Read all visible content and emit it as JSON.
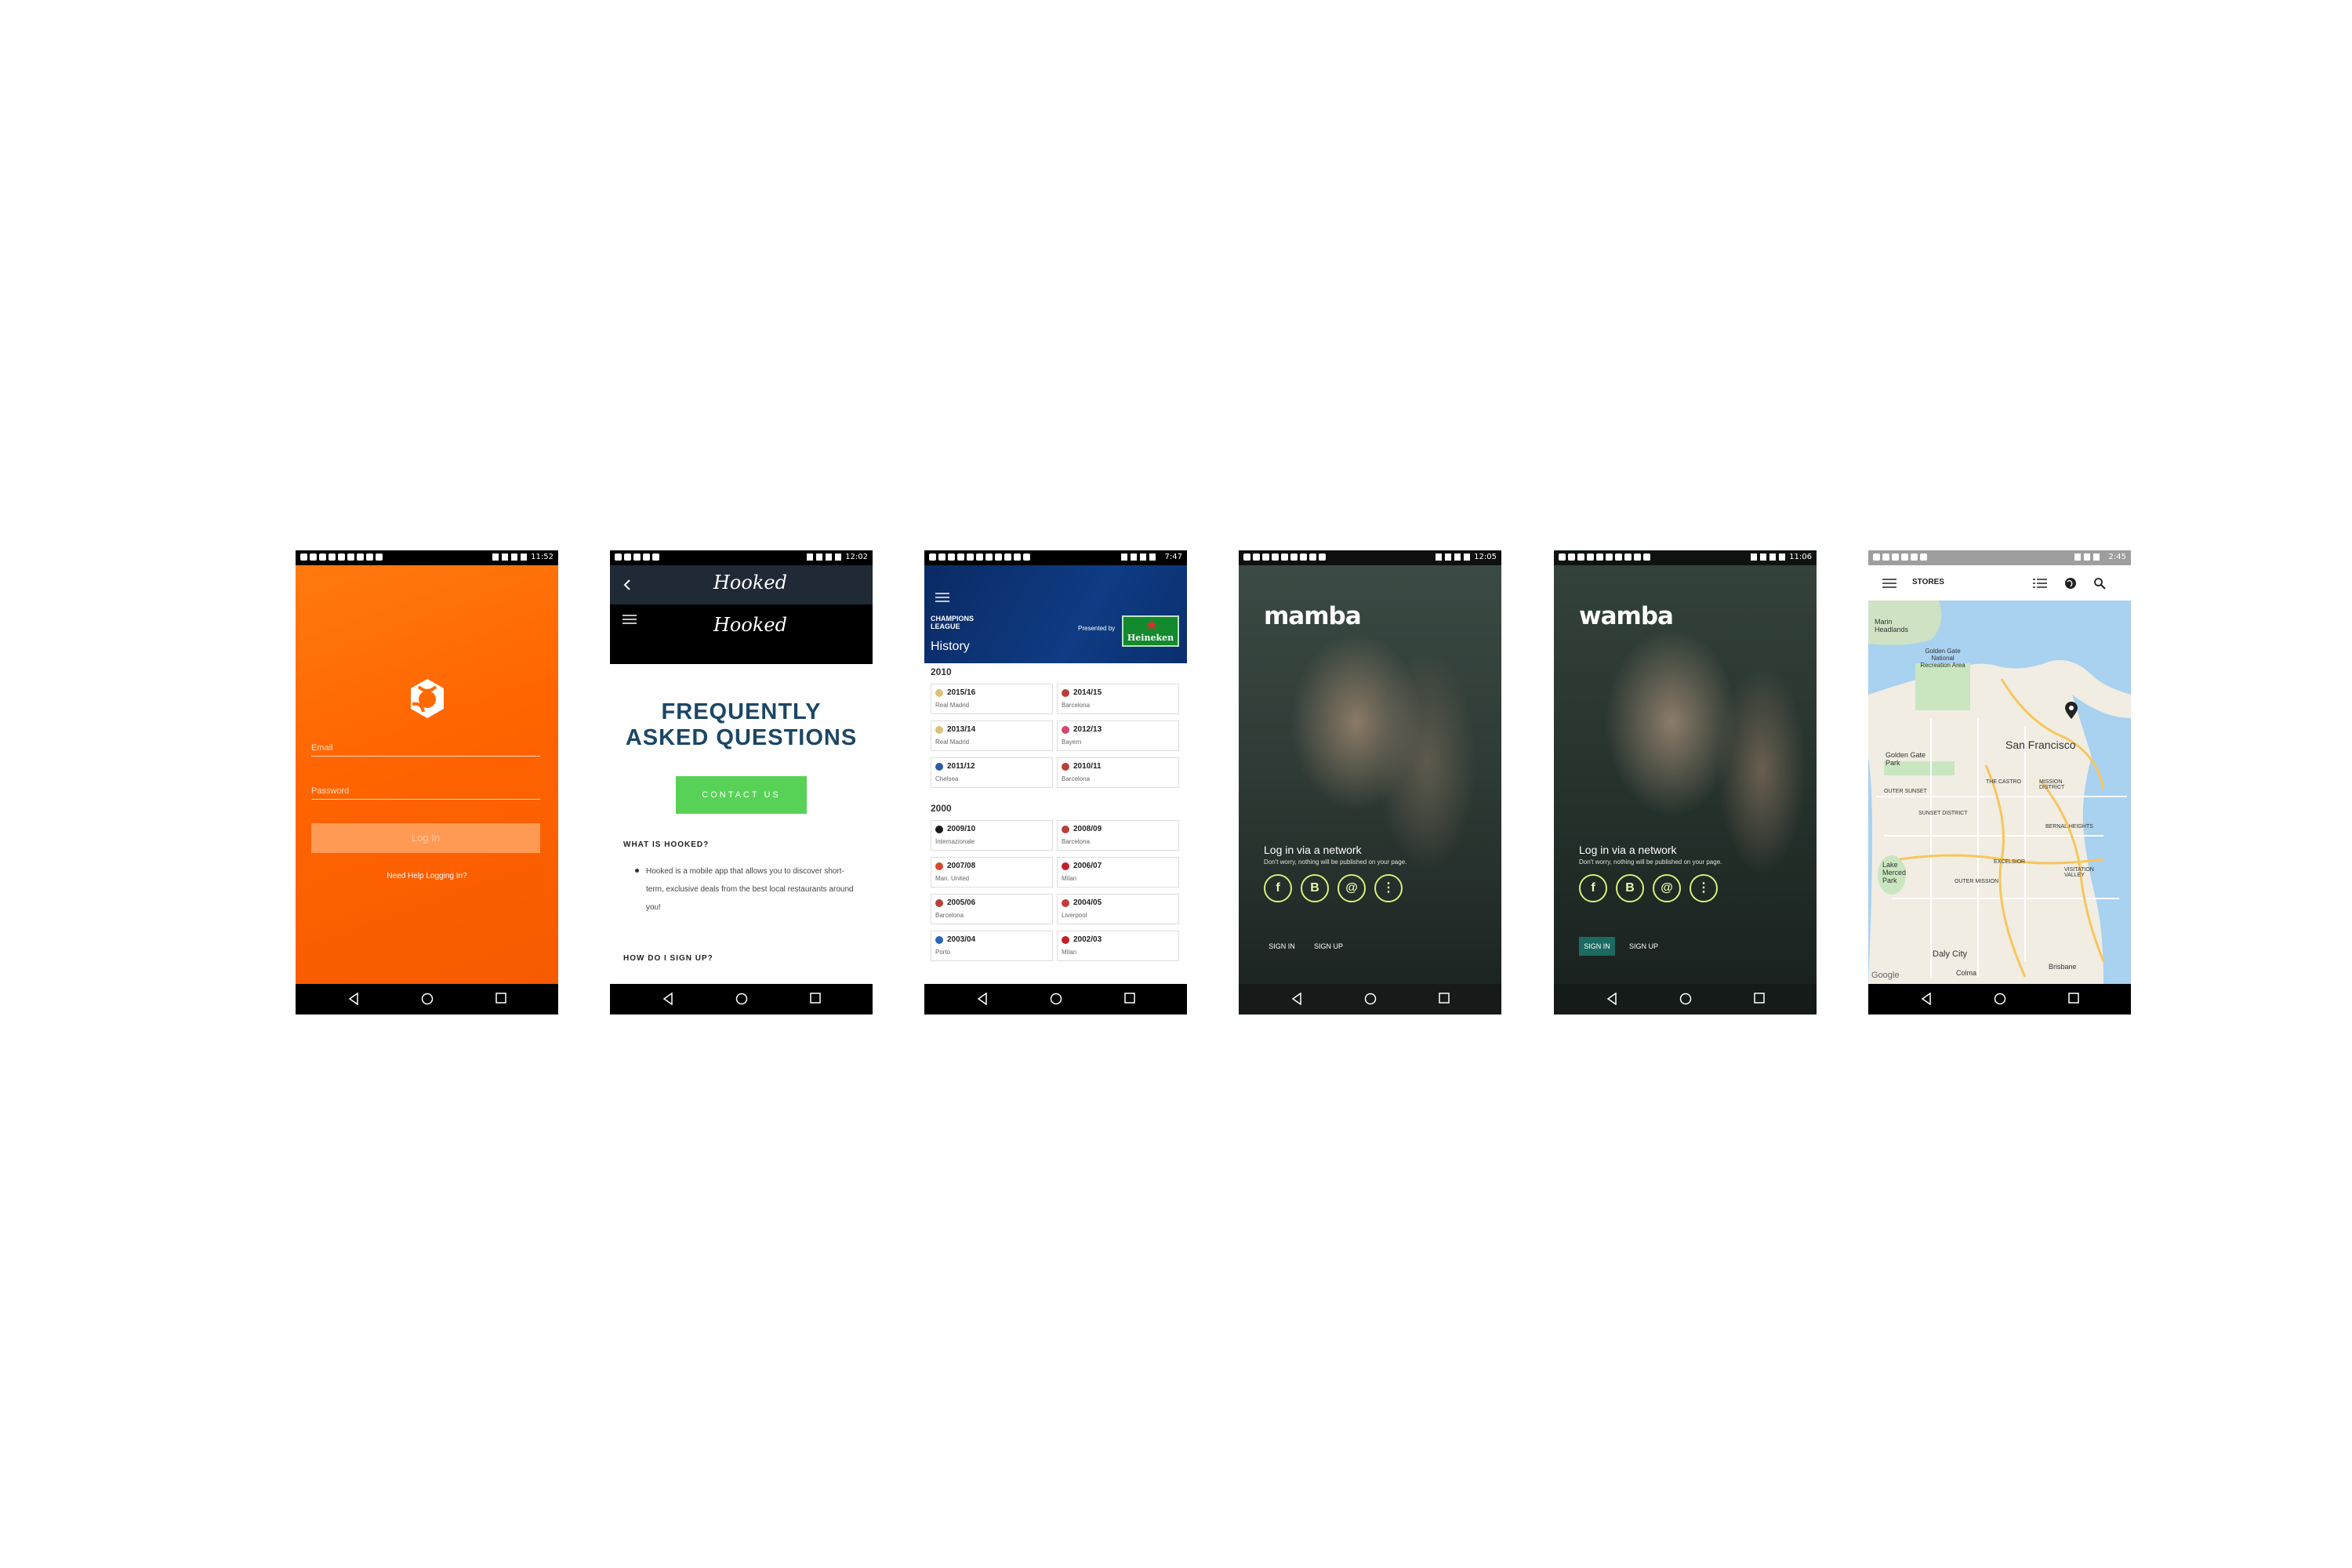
{
  "screens": {
    "p1": {
      "status_time": "11:52",
      "email_label": "Email",
      "password_label": "Password",
      "login_button": "Log In",
      "help_link": "Need Help Logging In?"
    },
    "p2": {
      "status_time": "12:02",
      "brand": "Hooked",
      "faq_title_1": "FREQUENTLY",
      "faq_title_2": "ASKED QUESTIONS",
      "contact_button": "CONTACT US",
      "q1": "WHAT IS HOOKED?",
      "a1": "Hooked is a mobile app that allows you to discover short-term, exclusive deals from the best local restaurants around you!",
      "q2": "HOW DO I SIGN UP?"
    },
    "p3": {
      "status_time": "7:47",
      "league": "CHAMPIONS LEAGUE",
      "presented_by": "Presented by",
      "sponsor": "Heineken",
      "title": "History",
      "decades": [
        {
          "label": "2010",
          "items": [
            {
              "year": "2015/16",
              "team": "Real Madrid",
              "color": "#d9c27a"
            },
            {
              "year": "2014/15",
              "team": "Barcelona",
              "color": "#b5413a"
            },
            {
              "year": "2013/14",
              "team": "Real Madrid",
              "color": "#d9c27a"
            },
            {
              "year": "2012/13",
              "team": "Bayern",
              "color": "#d6456c"
            },
            {
              "year": "2011/12",
              "team": "Chelsea",
              "color": "#2d5aa8"
            },
            {
              "year": "2010/11",
              "team": "Barcelona",
              "color": "#b5413a"
            }
          ]
        },
        {
          "label": "2000",
          "items": [
            {
              "year": "2009/10",
              "team": "Internazionale",
              "color": "#1b1b1b"
            },
            {
              "year": "2008/09",
              "team": "Barcelona",
              "color": "#b5413a"
            },
            {
              "year": "2007/08",
              "team": "Man. United",
              "color": "#d8492c"
            },
            {
              "year": "2006/07",
              "team": "Milan",
              "color": "#c0202a"
            },
            {
              "year": "2005/06",
              "team": "Barcelona",
              "color": "#b5413a"
            },
            {
              "year": "2004/05",
              "team": "Liverpool",
              "color": "#c33b3b"
            },
            {
              "year": "2003/04",
              "team": "Porto",
              "color": "#2a64b8"
            },
            {
              "year": "2002/03",
              "team": "Milan",
              "color": "#c0202a"
            }
          ]
        }
      ]
    },
    "p4": {
      "status_time": "12:05",
      "brand": "mamba",
      "net_title": "Log in via a network",
      "net_sub": "Don't worry, nothing will be published on your page.",
      "sign_in": "SIGN IN",
      "sign_up": "SIGN UP",
      "networks": [
        "f",
        "B",
        "@",
        "⋮"
      ]
    },
    "p5": {
      "status_time": "11:06",
      "brand": "wamba",
      "net_title": "Log in via a network",
      "net_sub": "Don't worry, nothing will be published on your page.",
      "sign_in": "SIGN IN",
      "sign_up": "SIGN UP",
      "networks": [
        "f",
        "B",
        "@",
        "⋮"
      ]
    },
    "p6": {
      "status_time": "2:45",
      "title": "STORES",
      "map_labels": {
        "city": "San Francisco",
        "marin": "Marin Headlands",
        "ggnra": "Golden Gate National Recreation Area",
        "ggpark": "Golden Gate Park",
        "outer_sunset": "OUTER SUNSET",
        "sunset": "SUNSET DISTRICT",
        "castro": "THE CASTRO",
        "mission": "MISSION DISTRICT",
        "bernal": "BERNAL HEIGHTS",
        "lake": "Lake Merced Park",
        "daly": "Daly City",
        "colma": "Colma",
        "brisbane": "Brisbane",
        "excelsior": "EXCELSIOR",
        "outer_mission": "OUTER MISSION",
        "visitation": "VISITATION VALLEY",
        "google": "Google"
      }
    }
  },
  "colors": {
    "orange": "#ff6a00",
    "faq_blue": "#1c4766",
    "contact_green": "#57d257",
    "ucl_blue": "#0f3c84",
    "net_green": "#d6f07a",
    "wamba_teal": "#1c6b62"
  }
}
